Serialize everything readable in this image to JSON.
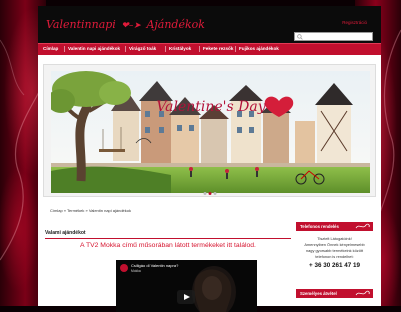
{
  "site": {
    "logo_part1": "Valentinnapi",
    "logo_part2": "Ajándékok",
    "top_link": "Regisztráció"
  },
  "search": {
    "placeholder": ""
  },
  "nav": {
    "items": [
      "Címlap",
      "Valentin napi ajándékok",
      "Virágző toák",
      "Kristályok",
      "Fekete rezsők",
      "Fujikos ajándékok"
    ]
  },
  "slider": {
    "caption": "Valentine's Day",
    "dot_count": 3,
    "active_dot": 1
  },
  "breadcrumb": "Címlap » Termékek » Valentin napi ajándékok",
  "main": {
    "title": "Valami ajándékot",
    "headline": "A TV2 Mokka című műsorában látott termékeket itt találod."
  },
  "video": {
    "title": "Csillgáo dl Valentin napra?",
    "channel": "Mokka"
  },
  "sidebar": {
    "phone_box": {
      "heading": "Telefonos rendelés",
      "line1": "Tisztelt Látogatóink!",
      "line2": "Amennyiben Önnek kényelmesebb",
      "line3": "nagy gyorsabb termékeink között",
      "line4": "telefonon is rendelhet:",
      "phone": "+ 36 30 261 47 19"
    },
    "next_box": {
      "heading": "Személyes átvétel"
    }
  },
  "colors": {
    "brand_red": "#c10f2e",
    "header_black": "#0b0b0b",
    "headline_red": "#d6142f"
  }
}
